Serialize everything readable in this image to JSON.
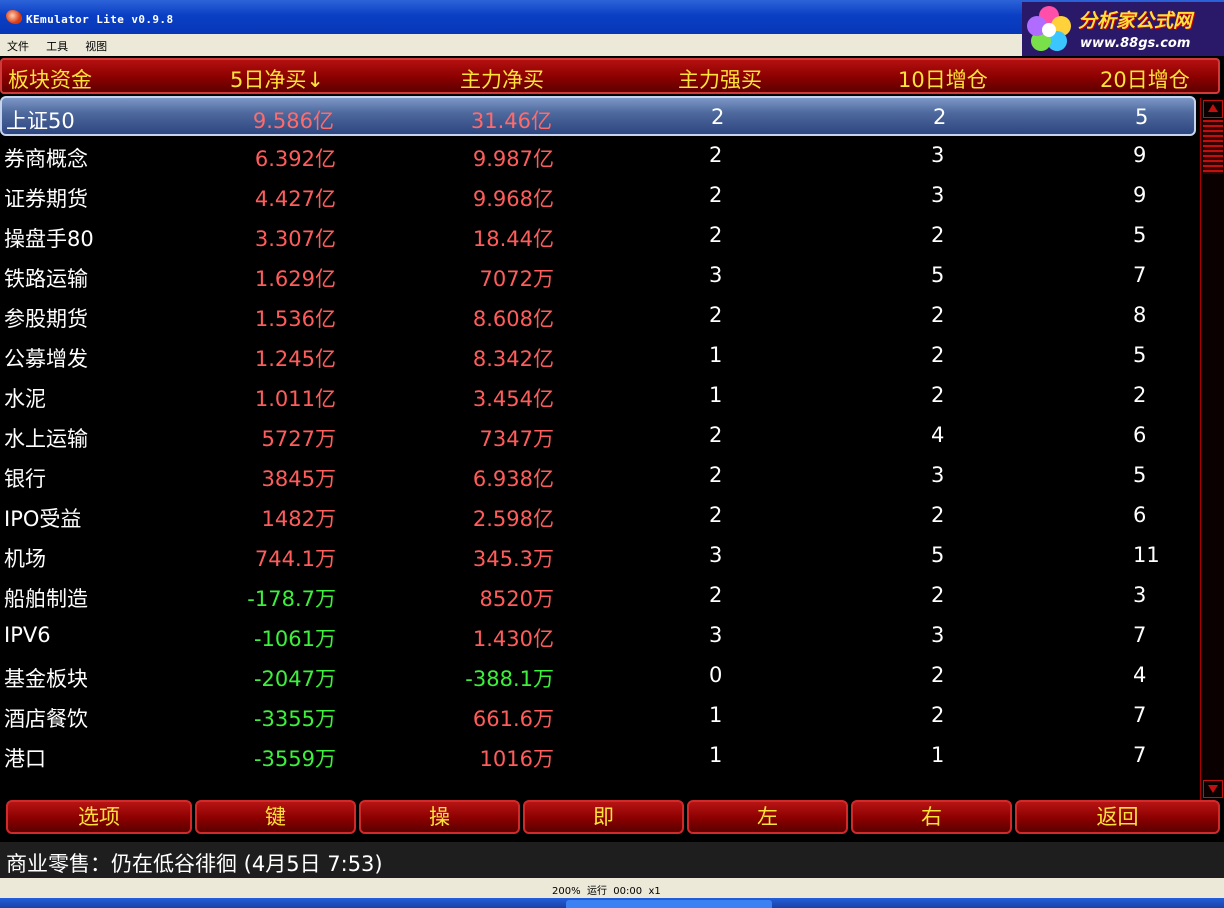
{
  "window": {
    "title": "KEmulator Lite v0.9.8"
  },
  "logo": {
    "brand": "分析家公式网",
    "url": "www.88gs.com"
  },
  "menu": [
    "文件",
    "工具",
    "视图"
  ],
  "table": {
    "headers": [
      "板块资金",
      "5日净买↓",
      "主力净买",
      "主力强买",
      "10日增仓",
      "20日增仓"
    ],
    "rows": [
      {
        "name": "上证50",
        "net5": "9.586亿",
        "main": "31.46亿",
        "strong": "2",
        "inc10": "2",
        "inc20": "5",
        "net5_sign": "pos",
        "main_sign": "pos"
      },
      {
        "name": "券商概念",
        "net5": "6.392亿",
        "main": "9.987亿",
        "strong": "2",
        "inc10": "3",
        "inc20": "9",
        "net5_sign": "pos",
        "main_sign": "pos"
      },
      {
        "name": "证券期货",
        "net5": "4.427亿",
        "main": "9.968亿",
        "strong": "2",
        "inc10": "3",
        "inc20": "9",
        "net5_sign": "pos",
        "main_sign": "pos"
      },
      {
        "name": "操盘手80",
        "net5": "3.307亿",
        "main": "18.44亿",
        "strong": "2",
        "inc10": "2",
        "inc20": "5",
        "net5_sign": "pos",
        "main_sign": "pos"
      },
      {
        "name": "铁路运输",
        "net5": "1.629亿",
        "main": "7072万",
        "strong": "3",
        "inc10": "5",
        "inc20": "7",
        "net5_sign": "pos",
        "main_sign": "pos"
      },
      {
        "name": "参股期货",
        "net5": "1.536亿",
        "main": "8.608亿",
        "strong": "2",
        "inc10": "2",
        "inc20": "8",
        "net5_sign": "pos",
        "main_sign": "pos"
      },
      {
        "name": "公募增发",
        "net5": "1.245亿",
        "main": "8.342亿",
        "strong": "1",
        "inc10": "2",
        "inc20": "5",
        "net5_sign": "pos",
        "main_sign": "pos"
      },
      {
        "name": "水泥",
        "net5": "1.011亿",
        "main": "3.454亿",
        "strong": "1",
        "inc10": "2",
        "inc20": "2",
        "net5_sign": "pos",
        "main_sign": "pos"
      },
      {
        "name": "水上运输",
        "net5": "5727万",
        "main": "7347万",
        "strong": "2",
        "inc10": "4",
        "inc20": "6",
        "net5_sign": "pos",
        "main_sign": "pos"
      },
      {
        "name": "银行",
        "net5": "3845万",
        "main": "6.938亿",
        "strong": "2",
        "inc10": "3",
        "inc20": "5",
        "net5_sign": "pos",
        "main_sign": "pos"
      },
      {
        "name": "IPO受益",
        "net5": "1482万",
        "main": "2.598亿",
        "strong": "2",
        "inc10": "2",
        "inc20": "6",
        "net5_sign": "pos",
        "main_sign": "pos"
      },
      {
        "name": "机场",
        "net5": "744.1万",
        "main": "345.3万",
        "strong": "3",
        "inc10": "5",
        "inc20": "11",
        "net5_sign": "pos",
        "main_sign": "pos"
      },
      {
        "name": "船舶制造",
        "net5": "-178.7万",
        "main": "8520万",
        "strong": "2",
        "inc10": "2",
        "inc20": "3",
        "net5_sign": "neg",
        "main_sign": "pos"
      },
      {
        "name": "IPV6",
        "net5": "-1061万",
        "main": "1.430亿",
        "strong": "3",
        "inc10": "3",
        "inc20": "7",
        "net5_sign": "neg",
        "main_sign": "pos"
      },
      {
        "name": "基金板块",
        "net5": "-2047万",
        "main": "-388.1万",
        "strong": "0",
        "inc10": "2",
        "inc20": "4",
        "net5_sign": "neg",
        "main_sign": "neg"
      },
      {
        "name": "酒店餐饮",
        "net5": "-3355万",
        "main": "661.6万",
        "strong": "1",
        "inc10": "2",
        "inc20": "7",
        "net5_sign": "neg",
        "main_sign": "pos"
      },
      {
        "name": "港口",
        "net5": "-3559万",
        "main": "1016万",
        "strong": "1",
        "inc10": "1",
        "inc20": "7",
        "net5_sign": "neg",
        "main_sign": "pos"
      }
    ]
  },
  "buttons": [
    "选项",
    "键",
    "操",
    "即",
    "左",
    "右",
    "返回"
  ],
  "ticker": "商业零售：仍在低谷徘徊 (4月5日 7:53)",
  "status": "200%  运行  00:00  x1",
  "colors": {
    "header_text": "#ffe23a",
    "positive": "#ff5c5c",
    "negative": "#3cf03c",
    "selection": "#4f6a9e"
  }
}
